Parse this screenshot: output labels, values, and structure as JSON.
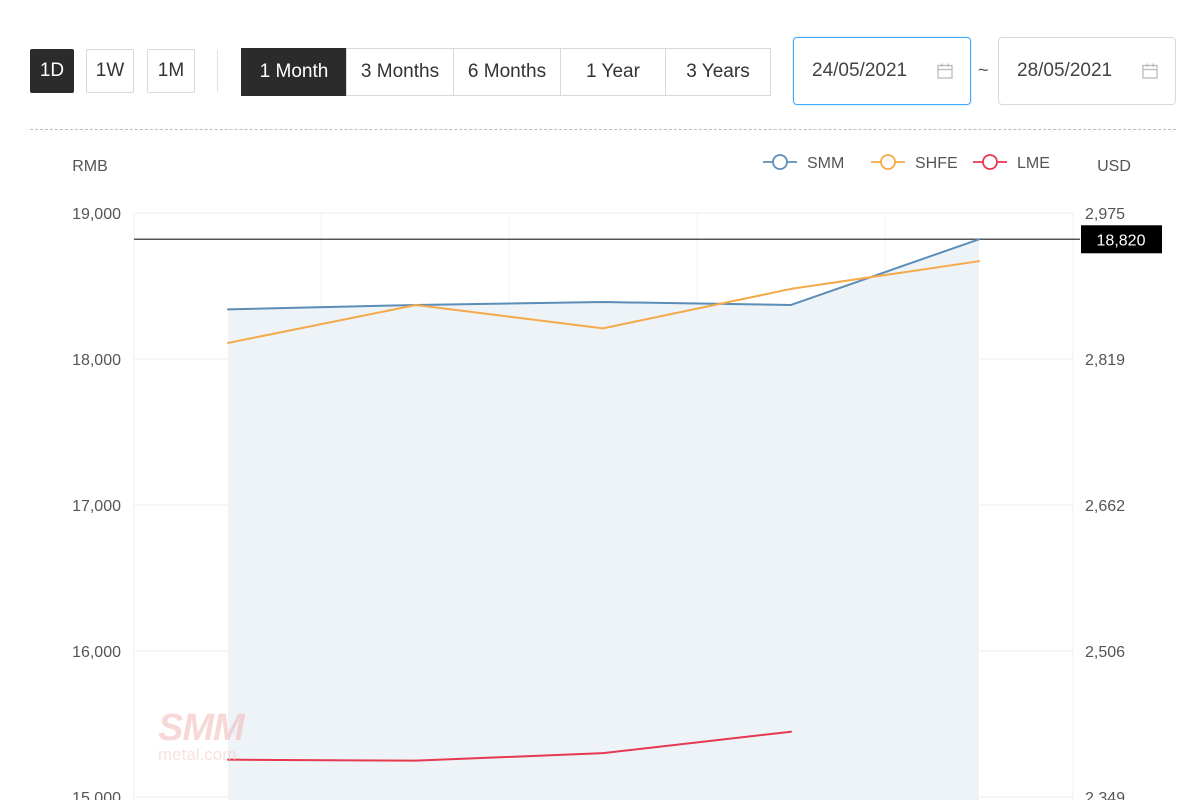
{
  "toolbar": {
    "intervals": [
      {
        "label": "1D",
        "active": true
      },
      {
        "label": "1W",
        "active": false
      },
      {
        "label": "1M",
        "active": false
      }
    ],
    "ranges": [
      {
        "label": "1 Month",
        "active": true
      },
      {
        "label": "3 Months",
        "active": false
      },
      {
        "label": "6 Months",
        "active": false
      },
      {
        "label": "1 Year",
        "active": false
      },
      {
        "label": "3 Years",
        "active": false
      }
    ],
    "date_from": "24/05/2021",
    "date_separator": "~",
    "date_to": "28/05/2021"
  },
  "watermark": {
    "brand": "SMM",
    "domain": "metal.com"
  },
  "colors": {
    "SMM": "#5b8db8",
    "SHFE": "#f5a94a",
    "LME": "#e8384f",
    "area": "#edf3f7",
    "crosshair": "#555555",
    "tooltip_bg": "#000000"
  },
  "chart_data": {
    "type": "line",
    "left_axis_label": "RMB",
    "right_axis_label": "USD",
    "left_ticks": [
      "19,000",
      "18,000",
      "17,000",
      "16,000",
      "15,000"
    ],
    "right_ticks": [
      "2,975",
      "2,819",
      "2,662",
      "2,506",
      "2,349"
    ],
    "ylim": [
      15000,
      19000
    ],
    "right_ylim": [
      2349,
      2975
    ],
    "legend_position": "top-right",
    "grid": true,
    "x_slots": 5,
    "series": [
      {
        "name": "SMM",
        "area": true,
        "values": [
          18340,
          18370,
          18390,
          18370,
          18820
        ]
      },
      {
        "name": "SHFE",
        "values": [
          18110,
          18370,
          18210,
          18480,
          18670
        ]
      },
      {
        "name": "LME",
        "axis": "right",
        "values": [
          2389,
          2388,
          2396,
          2419,
          null
        ]
      }
    ],
    "crosshair_value": 18820,
    "crosshair_label": "18,820"
  }
}
